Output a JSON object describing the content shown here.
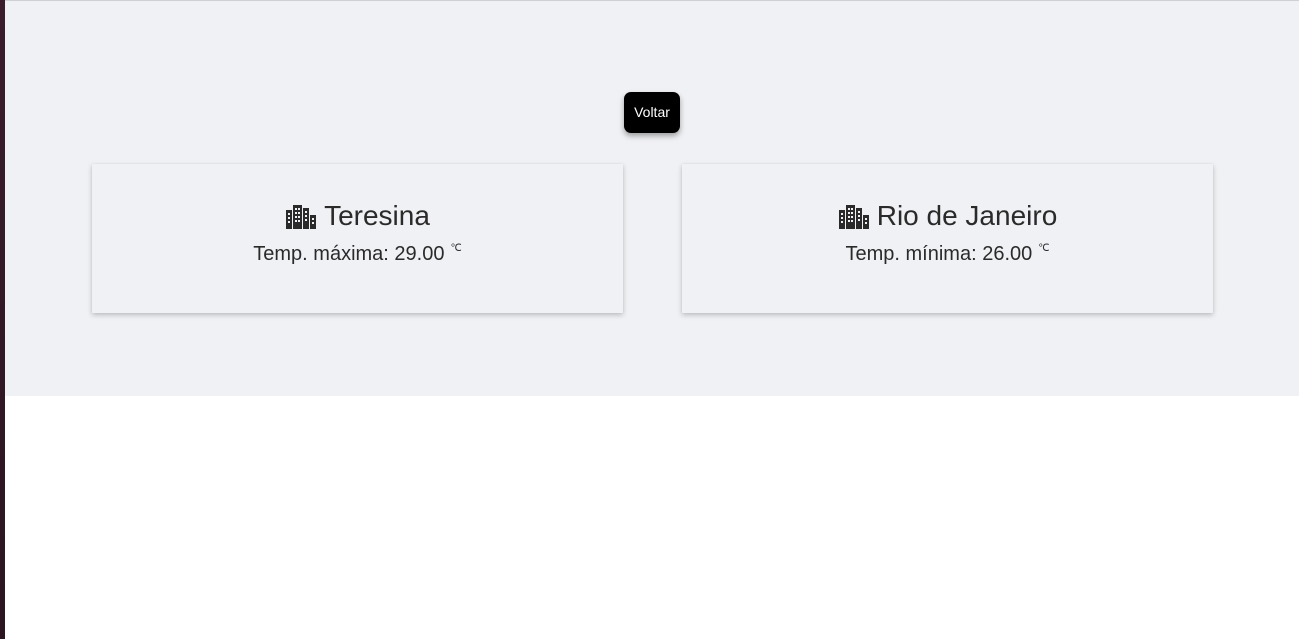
{
  "back_button": {
    "label": "Voltar"
  },
  "cards": [
    {
      "city": "Teresina",
      "icon": "city-buildings-icon",
      "temp_label": "Temp. máxima:",
      "temp_value": "29.00",
      "unit": "℃"
    },
    {
      "city": "Rio de Janeiro",
      "icon": "city-buildings-icon",
      "temp_label": "Temp. mínima:",
      "temp_value": "26.00",
      "unit": "℃"
    }
  ]
}
